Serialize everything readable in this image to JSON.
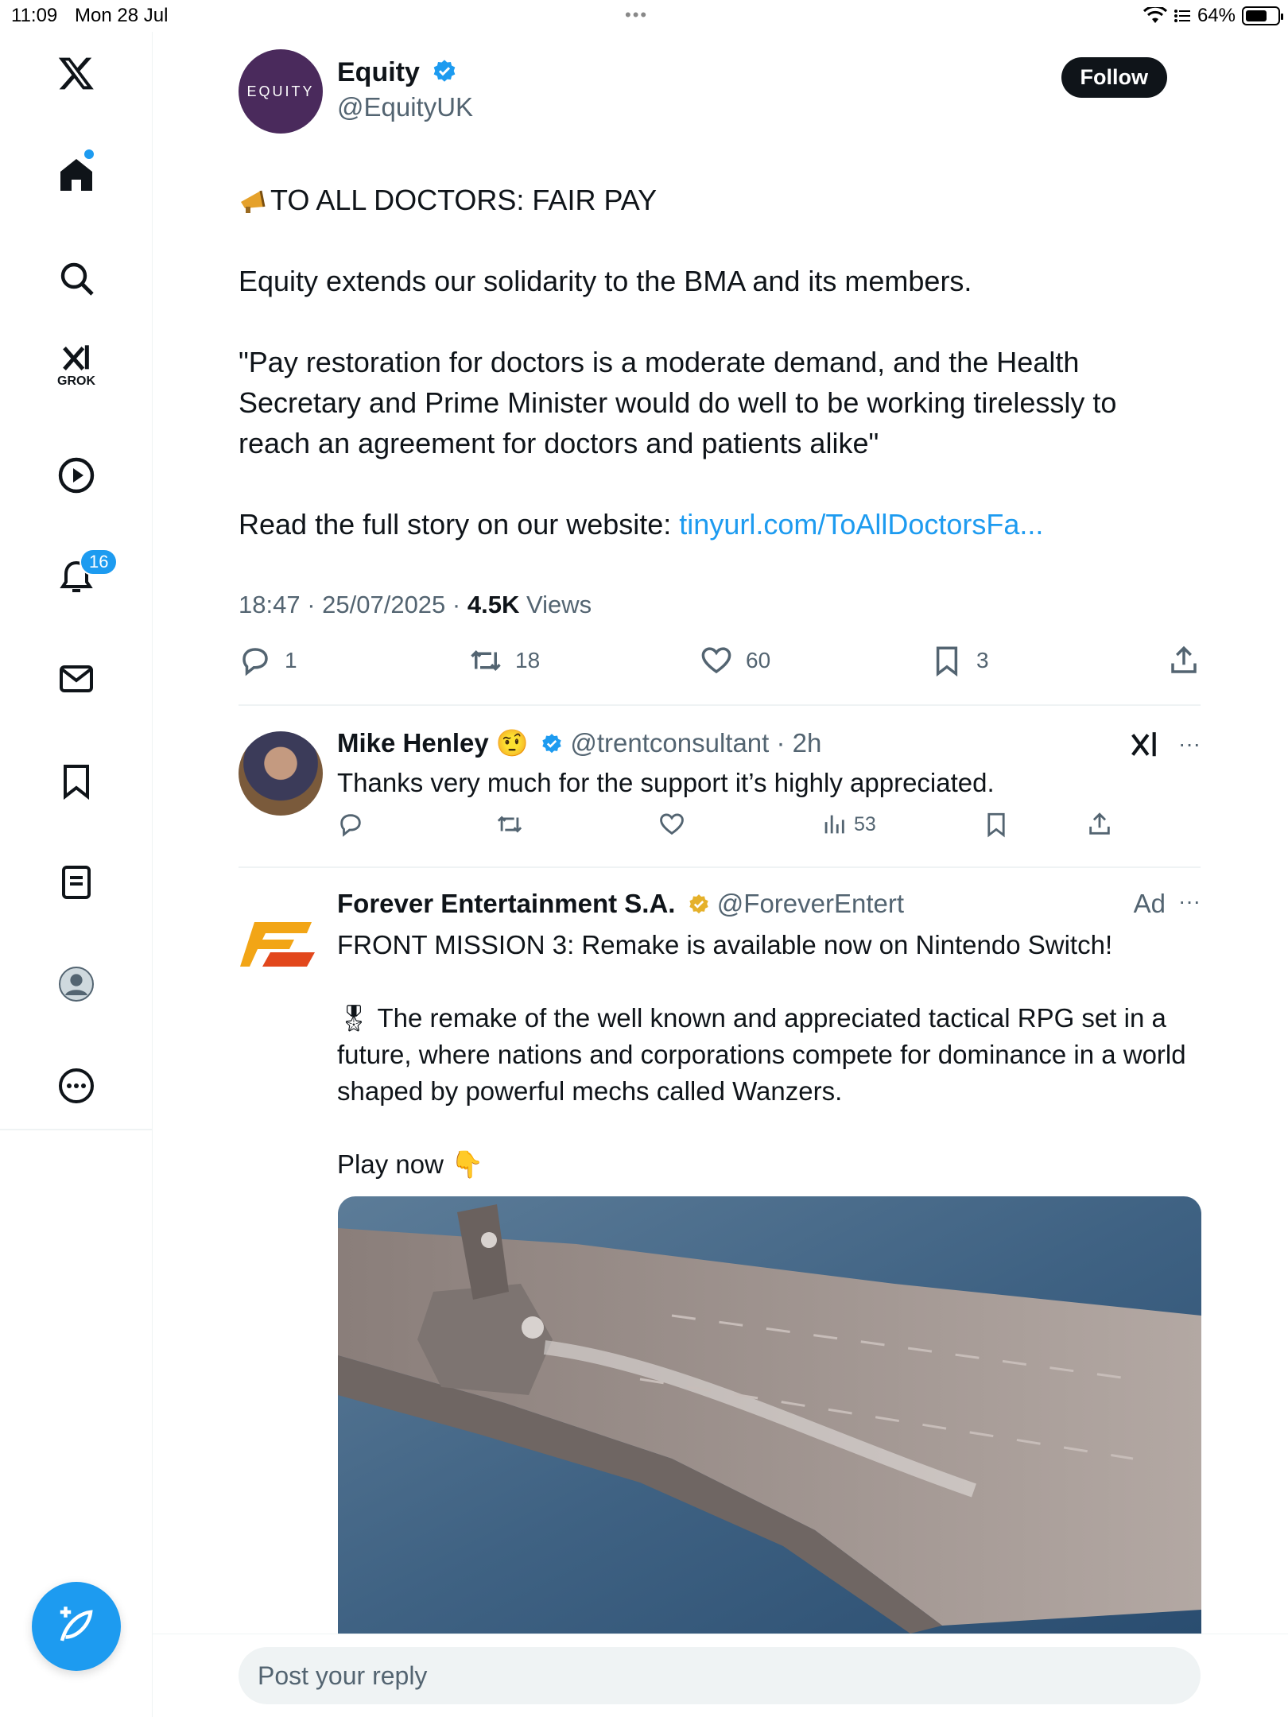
{
  "status_bar": {
    "time": "11:09",
    "date": "Mon 28 Jul",
    "dots": "•••",
    "battery": "64%",
    "battery_level": 0.64
  },
  "sidebar": {
    "notifications_badge": "16",
    "grok_label": "GROK",
    "items": [
      "x-logo",
      "home-icon",
      "search-icon",
      "grok-icon",
      "video-icon",
      "notifications-icon",
      "messages-icon",
      "bookmarks-icon",
      "lists-icon",
      "profile-icon",
      "more-icon"
    ]
  },
  "tweet": {
    "author_name": "Equity",
    "author_handle": "@EquityUK",
    "avatar_text": "EQUITY",
    "follow_label": "Follow",
    "headline": "TO ALL DOCTORS: FAIR PAY",
    "para1": "Equity extends our solidarity to the BMA and its members.",
    "para2": "\"Pay restoration for doctors is a moderate demand, and the Health Secretary and Prime Minister would do well to be working tirelessly to reach an agreement for doctors and patients alike\"",
    "para3_prefix": "Read the full story on our website: ",
    "link": "tinyurl.com/ToAllDoctorsFa...",
    "time": "18:47",
    "date": "25/07/2025",
    "views_count": "4.5K",
    "views_label": "Views",
    "replies": "1",
    "reposts": "18",
    "likes": "60",
    "bookmarks": "3"
  },
  "reply": {
    "author_name": "Mike Henley",
    "emoji": "🤨",
    "handle": "@trentconsultant",
    "age": "2h",
    "text": "Thanks very much for the support it’s highly appreciated.",
    "views": "53",
    "more": "···"
  },
  "ad": {
    "author_name": "Forever Entertainment S.A.",
    "handle": "@ForeverEntert",
    "ad_label": "Ad",
    "more": "···",
    "line1": "FRONT MISSION 3: Remake is available now on Nintendo Switch!",
    "medal": "🎖",
    "line2": " The remake of the well known and appreciated tactical RPG set in a future, where nations and corporations compete for dominance in a world shaped by powerful mechs called Wanzers.",
    "line3": "Play now  👇"
  },
  "reply_box": {
    "placeholder": "Post your reply"
  },
  "colors": {
    "accent": "#1d9bf0",
    "text": "#0f1419",
    "muted": "#536471",
    "gold": "#e5b12b"
  }
}
